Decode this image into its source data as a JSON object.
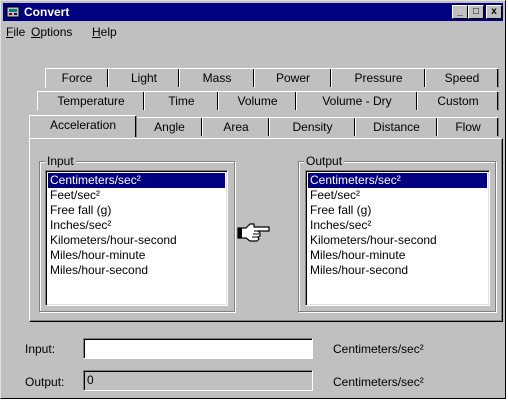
{
  "window": {
    "title": "Convert",
    "minimize_glyph": "_",
    "maximize_glyph": "□",
    "close_glyph": "x"
  },
  "menu": {
    "file": {
      "hotkey": "F",
      "rest": "ile"
    },
    "options": {
      "hotkey": "O",
      "rest": "ptions"
    },
    "help": {
      "hotkey": "H",
      "rest": "elp"
    }
  },
  "tabs": {
    "row1": [
      "Force",
      "Light",
      "Mass",
      "Power",
      "Pressure",
      "Speed"
    ],
    "row2": [
      "Temperature",
      "Time",
      "Volume",
      "Volume - Dry",
      "Custom"
    ],
    "row3": [
      "Acceleration",
      "Angle",
      "Area",
      "Density",
      "Distance",
      "Flow"
    ],
    "active": "Acceleration"
  },
  "input_group": {
    "label": "Input",
    "units": [
      "Centimeters/sec²",
      "Feet/sec²",
      "Free fall (g)",
      "Inches/sec²",
      "Kilometers/hour-second",
      "Miles/hour-minute",
      "Miles/hour-second"
    ],
    "selected": "Centimeters/sec²"
  },
  "output_group": {
    "label": "Output",
    "units": [
      "Centimeters/sec²",
      "Feet/sec²",
      "Free fall (g)",
      "Inches/sec²",
      "Kilometers/hour-second",
      "Miles/hour-minute",
      "Miles/hour-second"
    ],
    "selected": "Centimeters/sec²"
  },
  "hand_icon": "pointing-hand-icon",
  "fields": {
    "input_label": "Input:",
    "input_value": "",
    "input_unit": "Centimeters/sec²",
    "output_label": "Output:",
    "output_value": "0",
    "output_unit": "Centimeters/sec²"
  },
  "colors": {
    "titlebar": "#000080",
    "face": "#c0c0c0",
    "selection": "#000080"
  }
}
